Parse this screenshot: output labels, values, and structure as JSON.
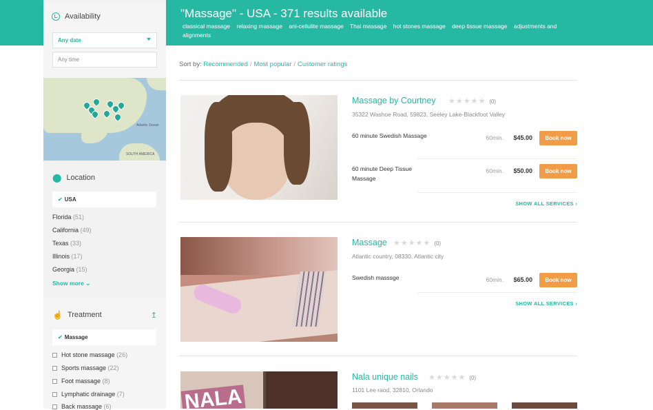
{
  "header": {
    "title": "\"Massage\" - USA - 371 results available",
    "tags": [
      "classical massage",
      "relaxing massage",
      "ani-cellulite massage",
      "Thai massage",
      "hot stones massage",
      "deep tissue massage",
      "adjustments and alignments"
    ]
  },
  "sidebar": {
    "availability": {
      "title": "Availability",
      "date_value": "Any date",
      "time_placeholder": "Any time"
    },
    "map": {
      "labels": [
        "Atlantic Ocean",
        "SOUTH AMERICA"
      ]
    },
    "location": {
      "title": "Location",
      "selected": "USA",
      "items": [
        {
          "name": "Florida",
          "count": "(51)"
        },
        {
          "name": "California",
          "count": "(49)"
        },
        {
          "name": "Texas",
          "count": "(33)"
        },
        {
          "name": "Illinois",
          "count": "(17)"
        },
        {
          "name": "Georgia",
          "count": "(15)"
        }
      ],
      "show_more": "Show more"
    },
    "treatment": {
      "title": "Treatment",
      "selected": "Massage",
      "items": [
        {
          "name": "Hot stone massage",
          "count": "(26)"
        },
        {
          "name": "Sports massage",
          "count": "(22)"
        },
        {
          "name": "Foot massage",
          "count": "(8)"
        },
        {
          "name": "Lymphatic drainage",
          "count": "(7)"
        },
        {
          "name": "Back massage",
          "count": "(6)"
        }
      ]
    }
  },
  "sort": {
    "label": "Sort by:",
    "options": [
      "Recommended",
      "Most popular",
      "Customer ratings"
    ]
  },
  "results": [
    {
      "name": "Massage by Courtney",
      "stars": "★★★★★",
      "rating_count": "(0)",
      "address": "35322 Washoe Road, 59823, Seeley Lake-Blackfoot Valley",
      "services": [
        {
          "name": "60 minute Swedish Massage",
          "duration": "60min.",
          "price": "$45.00",
          "book": "Book now"
        },
        {
          "name": "60 minute Deep Tissue Massage",
          "duration": "60min.",
          "price": "$50.00",
          "book": "Book now"
        }
      ],
      "show_all": "SHOW ALL SERVICES ›"
    },
    {
      "name": "Massage",
      "stars": "★★★★★",
      "rating_count": "(0)",
      "address": "Atlantic country, 08330, Atlantic city",
      "services": [
        {
          "name": "Swedish masssge",
          "duration": "60min.",
          "price": "$65.00",
          "book": "Book now"
        }
      ],
      "show_all": "SHOW ALL SERVICES ›"
    },
    {
      "name": "Nala unique nails",
      "stars": "★★★★★",
      "rating_count": "(0)",
      "address": "1101 Lee raod, 32810, Orlando",
      "image_text": "NALA"
    }
  ],
  "colors": {
    "accent": "#27b8a4",
    "book_button": "#f29c46"
  }
}
